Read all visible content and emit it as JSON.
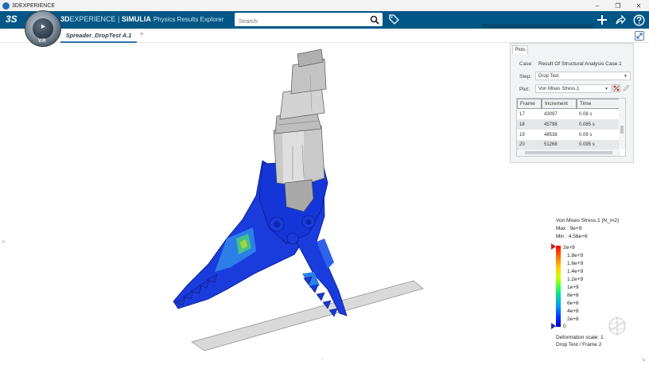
{
  "window": {
    "title": "3DEXPERIENCE",
    "controls": {
      "minimize": "–",
      "restore": "❐",
      "close": "✕"
    }
  },
  "topbar": {
    "logo": "3S",
    "brand_bold": "3D",
    "brand_rest": "EXPERIENCE",
    "brand_separator": " | ",
    "brand_simulia": "SIMULIA",
    "app_name": "Physics Results Explorer",
    "search_placeholder": "Search"
  },
  "compass": {
    "label": "V.R"
  },
  "tabs": [
    {
      "label": "Spreader_DropTest A.1"
    }
  ],
  "tab_add": "+",
  "plots_panel": {
    "tab_label": "Plots",
    "case_label": "Case:",
    "case_value": "Result Of Structural Analysis Case.1",
    "step_label": "Step:",
    "step_value": "Drop Test",
    "plot_label": "Plot:",
    "plot_value": "Von Mises Stress.1",
    "table": {
      "columns": [
        "Frame",
        "Increment",
        "Time"
      ],
      "rows": [
        {
          "frame": "17",
          "increment": "43097",
          "time": "0.08 s"
        },
        {
          "frame": "18",
          "increment": "45798",
          "time": "0.085 s"
        },
        {
          "frame": "19",
          "increment": "48538",
          "time": "0.09 s"
        },
        {
          "frame": "20",
          "increment": "51268",
          "time": "0.095 s"
        }
      ]
    }
  },
  "legend": {
    "title": "Von Mises Stress.1 (N_m2)",
    "max": "Max : 9e+9",
    "min": "Min : 4.56e+6",
    "ticks": [
      "2e+9",
      "1.8e+9",
      "1.6e+9",
      "1.4e+9",
      "1.2e+9",
      "1e+9",
      "8e+8",
      "6e+8",
      "4e+8",
      "2e+8",
      "0"
    ],
    "deformation": "Deformation scale: 1",
    "frame_info": "Drop Test / Frame 2"
  },
  "colors": {
    "topbar": "#005686",
    "accent": "#2f72a8",
    "model_blue": "#1230d8"
  }
}
